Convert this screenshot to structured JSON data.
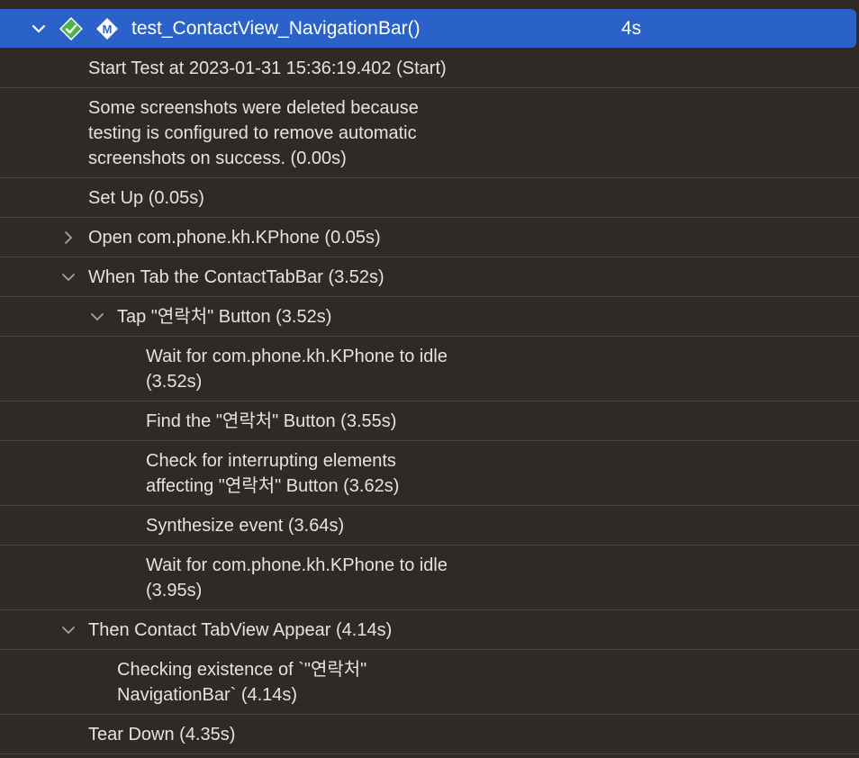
{
  "header": {
    "title": "test_ContactView_NavigationBar()",
    "duration": "4s"
  },
  "rows": [
    {
      "label": "Start Test at 2023-01-31 15:36:19.402 (Start)"
    },
    {
      "label": "Some screenshots were deleted because\ntesting is configured to remove automatic\nscreenshots on success. (0.00s)"
    },
    {
      "label": "Set Up (0.05s)"
    },
    {
      "label": "Open com.phone.kh.KPhone (0.05s)"
    },
    {
      "label": "When Tab the ContactTabBar (3.52s)"
    },
    {
      "label": "Tap \"연락처\" Button (3.52s)"
    },
    {
      "label": "Wait for com.phone.kh.KPhone to idle\n(3.52s)"
    },
    {
      "label": "Find the \"연락처\" Button (3.55s)"
    },
    {
      "label": "Check for interrupting elements\naffecting \"연락처\" Button (3.62s)"
    },
    {
      "label": "Synthesize event (3.64s)"
    },
    {
      "label": "Wait for com.phone.kh.KPhone to idle\n(3.95s)"
    },
    {
      "label": "Then Contact TabView Appear (4.14s)"
    },
    {
      "label": "Checking existence of `\"연락처\"\nNavigationBar` (4.14s)"
    },
    {
      "label": "Tear Down (4.35s)"
    }
  ],
  "icons": {
    "collapse": "chevron-down-icon",
    "expand": "chevron-right-icon",
    "passed": "checkmark-diamond-icon",
    "test_method": "m-diamond-icon"
  },
  "colors": {
    "selection": "#2a62c9",
    "passed": "#4fb34a",
    "background": "#2f2a27"
  }
}
